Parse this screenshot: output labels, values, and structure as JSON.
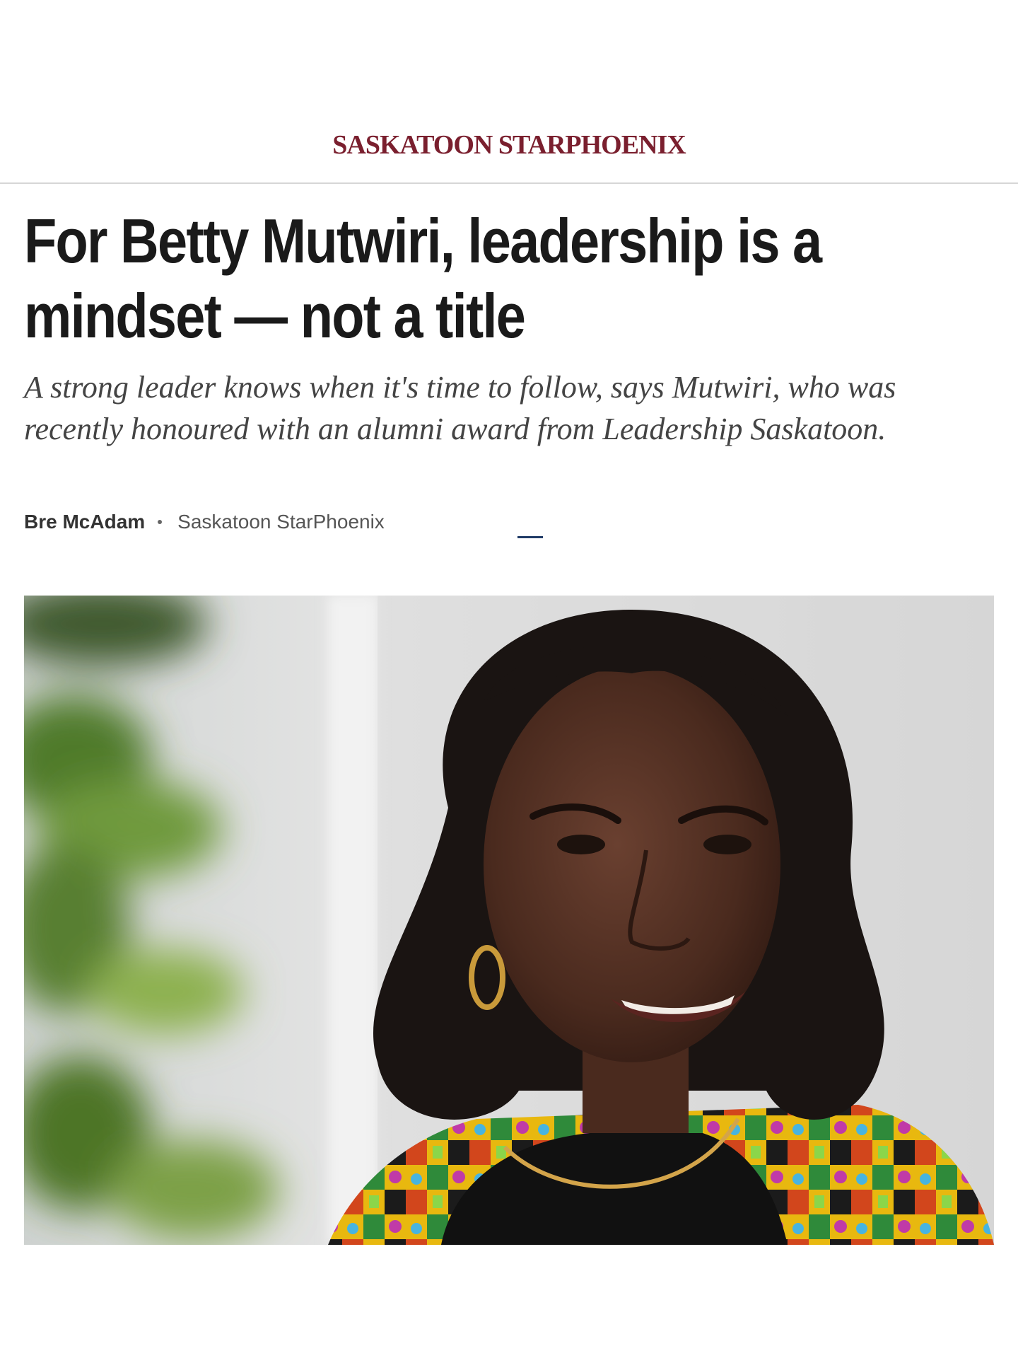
{
  "masthead": {
    "logo_text": "SASKATOON STARPHOENIX",
    "brand_color": "#7a1f2e"
  },
  "article": {
    "headline": "For Betty Mutwiri, leadership is a mindset — not a title",
    "dek": "A strong leader knows when it's time to follow, says Mutwiri, who was recently honoured with an alumni award from Leadership Saskatoon.",
    "byline": {
      "author": "Bre McAdam",
      "publication": "Saskatoon StarPhoenix"
    }
  },
  "hero_image": {
    "subject": "portrait-photo"
  }
}
